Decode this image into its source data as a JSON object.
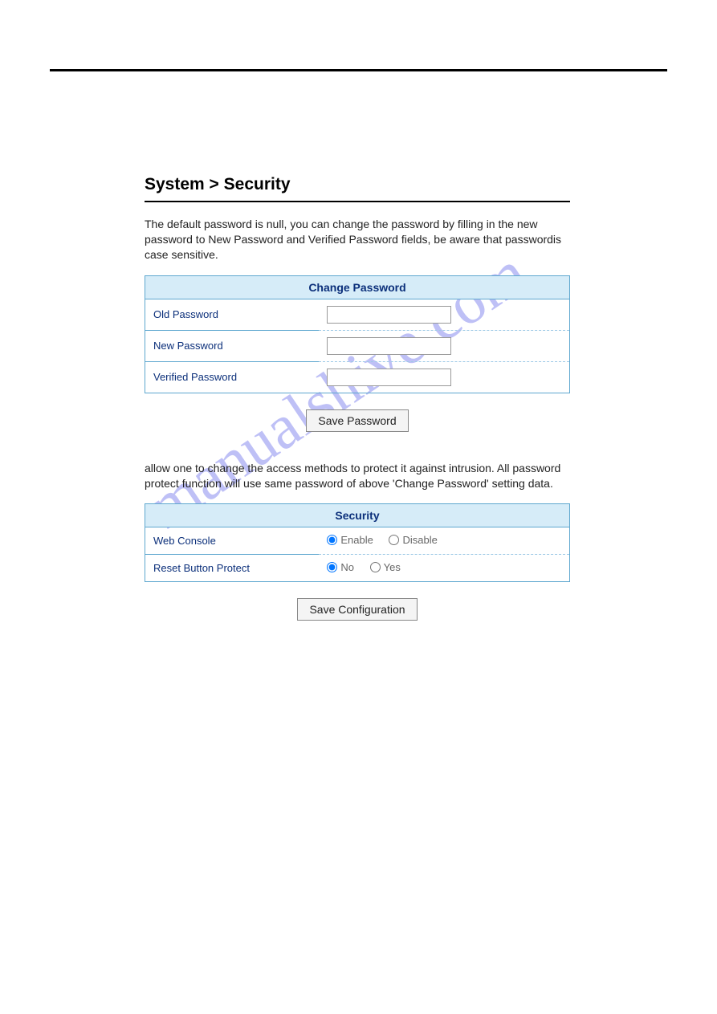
{
  "watermark": "manualshive.com",
  "breadcrumb": "System > Security",
  "intro_text": "The default password is null, you can change the password by filling in the new password to New Password and Verified Password fields, be aware that passwordis case sensitive.",
  "change_password": {
    "header": "Change Password",
    "rows": {
      "old": {
        "label": "Old Password",
        "value": ""
      },
      "new": {
        "label": "New Password",
        "value": ""
      },
      "verified": {
        "label": "Verified Password",
        "value": ""
      }
    },
    "button": "Save Password"
  },
  "security_intro": "allow one to change the access methods to protect it against intrusion. All password protect function will use same password of above 'Change Password' setting data.",
  "security": {
    "header": "Security",
    "web_console": {
      "label": "Web Console",
      "enable": "Enable",
      "disable": "Disable",
      "selected": "enable"
    },
    "reset_button": {
      "label": "Reset Button Protect",
      "no": "No",
      "yes": "Yes",
      "selected": "no"
    },
    "button": "Save Configuration"
  }
}
